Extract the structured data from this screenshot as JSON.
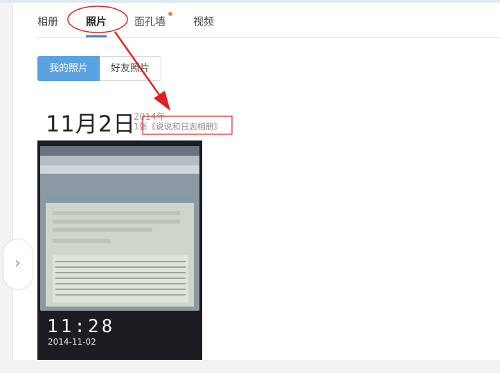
{
  "tabs": [
    {
      "label": "相册"
    },
    {
      "label": "照片"
    },
    {
      "label": "面孔墙"
    },
    {
      "label": "视频"
    }
  ],
  "segment": {
    "mine": "我的照片",
    "friends": "好友照片"
  },
  "group": {
    "day": "11月2日",
    "year": "2014年",
    "count": "1张《说说和日志相册》"
  },
  "photo": {
    "clock": "11:28",
    "stamp": "2014-11-02"
  },
  "colors": {
    "accent": "#5aa2e0",
    "annotation": "#e02020",
    "dot": "#f5832b"
  },
  "icons": {
    "nav_left": "chevron-left-icon"
  }
}
